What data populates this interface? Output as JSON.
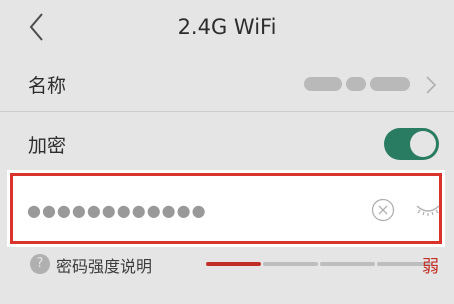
{
  "header": {
    "title": "2.4G WiFi",
    "back_icon": "chevron-left-icon"
  },
  "settings": {
    "name_label": "名称",
    "name_value_redacted": true,
    "encryption_label": "加密",
    "encryption_enabled": true
  },
  "password": {
    "value": "●●●●●●●●●●●●",
    "clear_icon": "clear-circle-icon",
    "visibility_icon": "eye-closed-icon"
  },
  "strength": {
    "help_icon_glyph": "?",
    "label": "密码强度说明",
    "level_text": "弱",
    "level": 1,
    "levels_total": 4
  },
  "colors": {
    "accent_red": "#d9332b",
    "toggle_on": "#2e8b6e",
    "bar_inactive": "#d4d4d4"
  }
}
